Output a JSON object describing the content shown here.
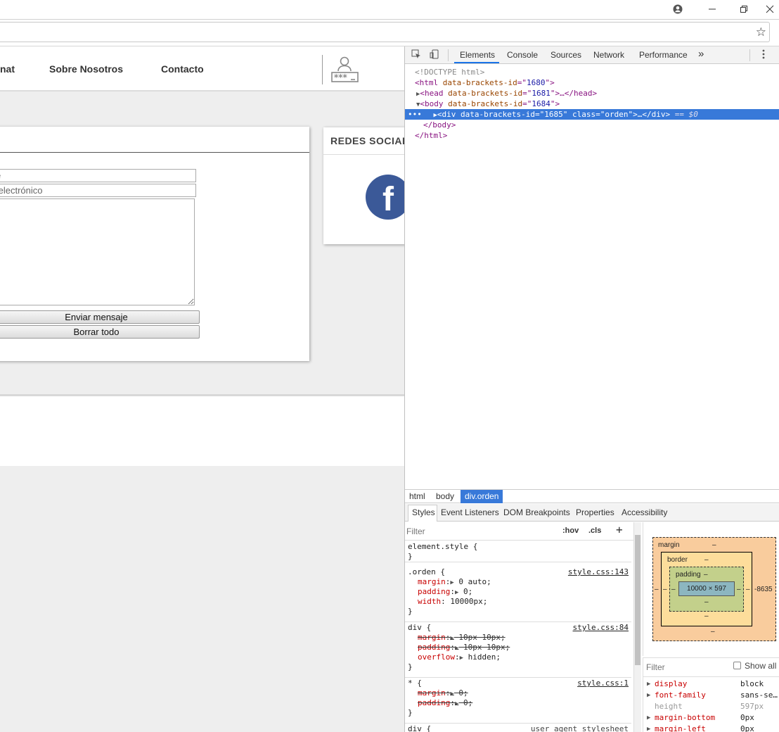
{
  "nav": {
    "partial_item": "nat",
    "about": "Sobre Nosotros",
    "contact": "Contacto"
  },
  "contact_form": {
    "name_placeholder": "e",
    "email_placeholder": " electrónico",
    "send_label": "Enviar mensaje",
    "clear_label": "Borrar todo"
  },
  "social": {
    "title": "REDES SOCIALES",
    "facebook_glyph": "f"
  },
  "devtools": {
    "tabs": [
      "Elements",
      "Console",
      "Sources",
      "Network",
      "Performance"
    ],
    "more": "»",
    "dom": {
      "doctype": "<!DOCTYPE html>",
      "html_open": "html",
      "attr_name": "data-brackets-id",
      "html_id": "1680",
      "head_id": "1681",
      "body_id": "1684",
      "div_id": "1685",
      "div_class": "orden",
      "selected_marker": "== $0",
      "body_close": "</body>",
      "html_close": "</html>"
    },
    "breadcrumbs": [
      "html",
      "body",
      "div.orden"
    ],
    "style_tabs": [
      "Styles",
      "Event Listeners",
      "DOM Breakpoints",
      "Properties",
      "Accessibility"
    ],
    "filter_placeholder": "Filter",
    "hov": ":hov",
    "cls": ".cls",
    "rules": {
      "element_style": "element.style {",
      "orden_selector": ".orden {",
      "orden_source": "style.css:143",
      "orden_margin": "0 auto;",
      "orden_padding": "0;",
      "orden_width": "10000px;",
      "div_selector": "div {",
      "div_source": "style.css:84",
      "div_margin": "10px 10px;",
      "div_padding": "10px 10px;",
      "div_overflow": "hidden;",
      "star_selector": "* {",
      "star_source": "style.css:1",
      "star_margin": "0;",
      "star_padding": "0;",
      "ua_selector": "div {",
      "ua_source": "user agent stylesheet"
    },
    "box_model": {
      "margin_label": "margin",
      "border_label": "border",
      "padding_label": "padding",
      "dash": "–",
      "content": "10000 × 597",
      "right_margin": "-8635"
    },
    "computed": {
      "filter_placeholder": "Filter",
      "show_all": "Show all",
      "rows": [
        {
          "name": "display",
          "value": "block"
        },
        {
          "name": "font-family",
          "value": "sans-se…"
        },
        {
          "name": "height",
          "value": "597px"
        },
        {
          "name": "margin-bottom",
          "value": "0px"
        },
        {
          "name": "margin-left",
          "value": "0px"
        }
      ]
    }
  }
}
